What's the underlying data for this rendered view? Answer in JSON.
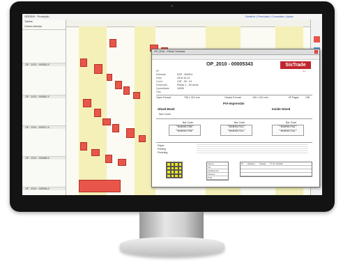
{
  "app": {
    "window_title": "ORDEM · Produção",
    "menu_right": "Detalhe | Produção | Consultas | Ajuda"
  },
  "sidebar": {
    "header1": "Tarefas",
    "header2": "Ordens Abertas",
    "rows": [
      "OP - 2010 - 000553-0",
      "OP - 2010 - 000562-0",
      "OP - 2010 - 000571-0",
      "OP - 2010 - 000588-0",
      "OP - 2010 - 000596-0"
    ]
  },
  "dialog": {
    "title": "OP_2010 - Fichas Técnicas",
    "op_number": "OP_2010 - 00005343",
    "logo": "SisTrade",
    "logo_sub": "3.1",
    "fields": [
      {
        "label": "Nº",
        "value": ""
      },
      {
        "label": "Entidade",
        "value": "EXP - 000431"
      },
      {
        "label": "Data",
        "value": "2010-10-12"
      },
      {
        "label": "Cond.",
        "value": "CAT - 00 - 01"
      },
      {
        "label": "Descrição",
        "value": "Rótulo 1 - 40 cores"
      },
      {
        "label": "Quantidade",
        "value": "10000"
      },
      {
        "label": "Obs.",
        "value": ""
      }
    ],
    "sizes": {
      "open_label": "Open Format",
      "open_value": "750 x 310 mm",
      "closed_label": "Closed Format",
      "closed_value": "150 x 310 mm",
      "pages_label": "Nº Pages",
      "pages_value": "136"
    },
    "section_pre": "Pré-Impressão",
    "section_gluedbook": "Glued Book",
    "section_insidegluded": "Inside Glued",
    "cover_label": "Sub Cover",
    "barcodes": [
      {
        "label": "Bar Code",
        "value1": "*08095790*",
        "value2": "*08095790*"
      },
      {
        "label": "Bar Code",
        "value1": "*08095791*",
        "value2": "*08095791*"
      },
      {
        "label": "Bar Code",
        "value1": "*08095792*",
        "value2": "*08095792*"
      }
    ],
    "paper_label": "Paper",
    "printing_label": "Printing",
    "finishing_label": "Finishing",
    "table1": [
      "Layout",
      "Cor",
      "Acabamento",
      "Pantone",
      "Tinta"
    ],
    "table2": [
      "Nº",
      "Máquina",
      "Chapas",
      "Nº de Trabalho"
    ]
  },
  "colors": {
    "task": "#e8564a",
    "band_light": "#fbf7c8",
    "band_mid": "#f0ecb0",
    "logo": "#c0262d"
  }
}
